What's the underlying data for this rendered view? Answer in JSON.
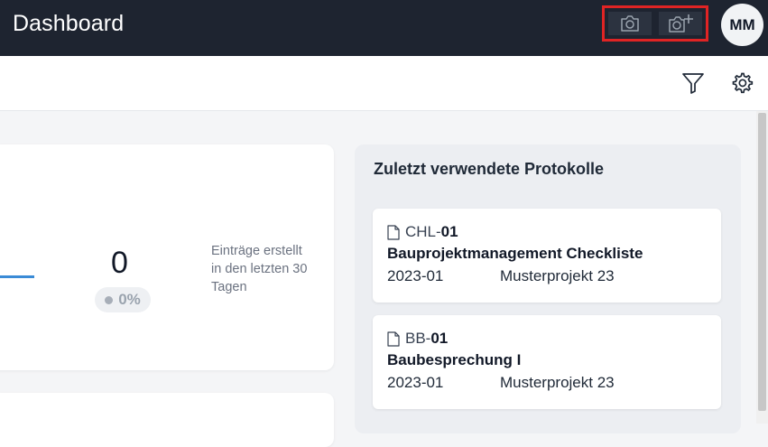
{
  "header": {
    "title": "Dashboard",
    "avatar_initials": "MM"
  },
  "stats": {
    "count": "0",
    "percent": "0%",
    "description": "Einträge erstellt in den letzten 30 Tagen"
  },
  "recent_protocols": {
    "title": "Zuletzt verwendete Protokolle",
    "items": [
      {
        "code_prefix": "CHL-",
        "code_number": "01",
        "name": "Bauprojektmanagement Checkliste",
        "date": "2023-01",
        "project": "Musterprojekt 23"
      },
      {
        "code_prefix": "BB-",
        "code_number": "01",
        "name": "Baubesprechung I",
        "date": "2023-01",
        "project": "Musterprojekt 23"
      }
    ]
  },
  "colors": {
    "topbar": "#1e2430",
    "highlight": "#e02424",
    "accent_line": "#3a8bd6"
  }
}
